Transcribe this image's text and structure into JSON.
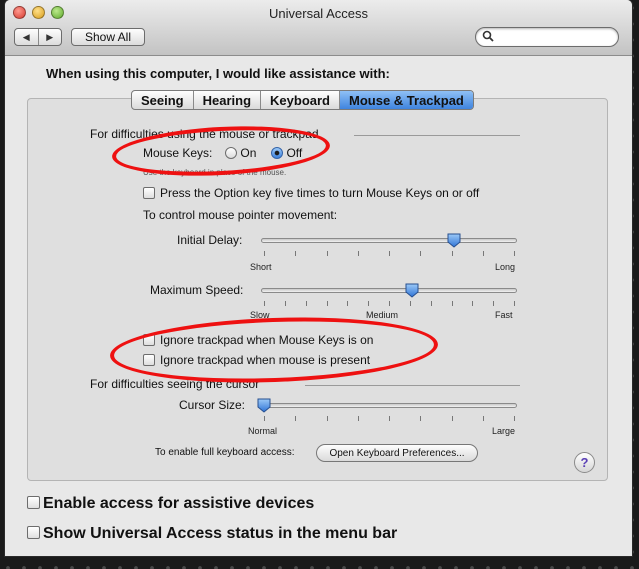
{
  "window": {
    "title": "Universal Access"
  },
  "toolbar": {
    "back_icon": "◀",
    "forward_icon": "▶",
    "show_all": "Show All",
    "search_placeholder": ""
  },
  "heading": "When using this computer, I would like assistance with:",
  "tabs": [
    {
      "label": "Seeing",
      "active": false
    },
    {
      "label": "Hearing",
      "active": false
    },
    {
      "label": "Keyboard",
      "active": false
    },
    {
      "label": "Mouse & Trackpad",
      "active": true
    }
  ],
  "mouse": {
    "section_title": "For difficulties using the mouse or trackpad",
    "mouse_keys_label": "Mouse Keys:",
    "on_label": "On",
    "off_label": "Off",
    "selected": "Off",
    "hint": "Use the keyboard in place of the mouse.",
    "option_key_label": "Press the Option key five times to turn Mouse Keys on or off",
    "control_label": "To control mouse pointer movement:",
    "initial_delay": {
      "label": "Initial Delay:",
      "min_label": "Short",
      "max_label": "Long",
      "value": 0.76
    },
    "max_speed": {
      "label": "Maximum Speed:",
      "min_label": "Slow",
      "mid_label": "Medium",
      "max_label": "Fast",
      "value": 0.59
    },
    "ignore_trackpad_keys": "Ignore trackpad when Mouse Keys is on",
    "ignore_trackpad_mouse": "Ignore trackpad when mouse is present"
  },
  "cursor": {
    "section_title": "For difficulties seeing the cursor",
    "size": {
      "label": "Cursor Size:",
      "min_label": "Normal",
      "max_label": "Large",
      "value": 0.0
    }
  },
  "keyboard_access": {
    "label": "To enable full keyboard access:",
    "button": "Open Keyboard Preferences..."
  },
  "help_icon": "?",
  "assistive_label": "Enable access for assistive devices",
  "status_label": "Show Universal Access status in the menu bar",
  "colors": {
    "accent": "#3d82de",
    "annotation": "#ee1111"
  }
}
